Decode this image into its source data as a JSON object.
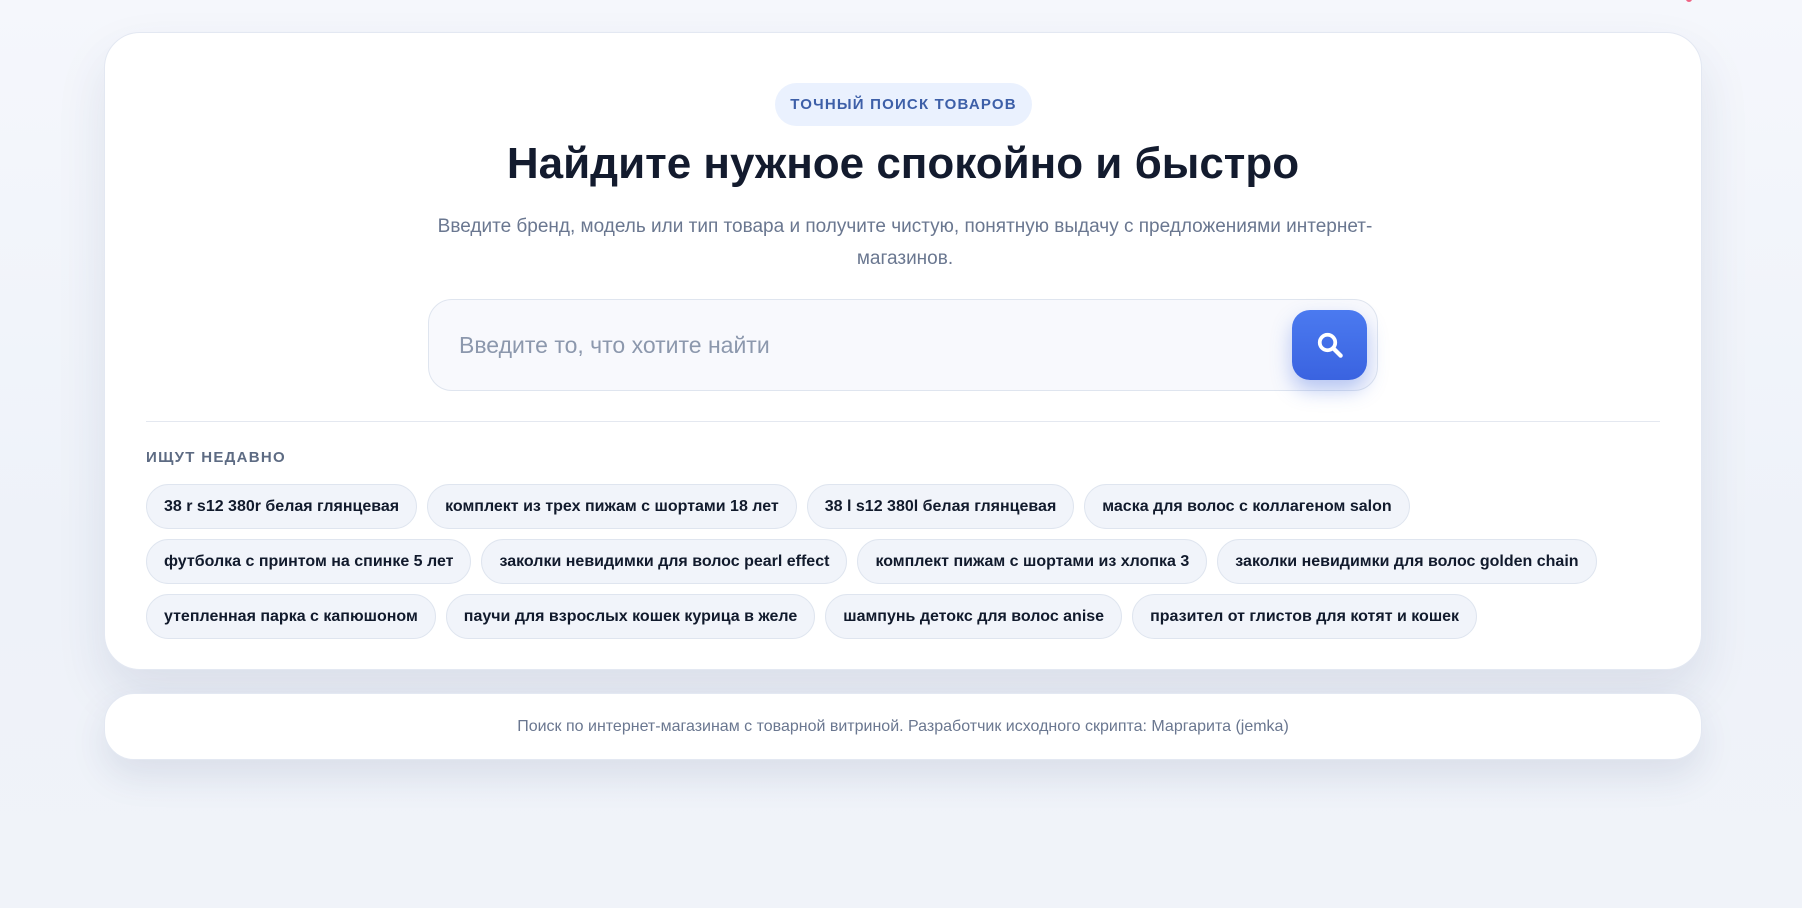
{
  "hero": {
    "badge": "ТОЧНЫЙ ПОИСК ТОВАРОВ",
    "title": "Найдите нужное спокойно и быстро",
    "subtitle": "Введите бренд, модель или тип товара и получите чистую, понятную выдачу с предложениями интернет-магазинов."
  },
  "search": {
    "placeholder": "Введите то, что хотите найти",
    "value": "",
    "button_icon": "search-icon",
    "accent_color": "#3d6ae8"
  },
  "recent": {
    "title": "ИЩУТ НЕДАВНО",
    "items": [
      "38 r s12 380r белая глянцевая",
      "комплект из трех пижам с шортами 18 лет",
      "38 l s12 380l белая глянцевая",
      "маска для волос с коллагеном salon",
      "футболка с принтом на спинке 5 лет",
      "заколки невидимки для волос pearl effect",
      "комплект пижам с шортами из хлопка 3",
      "заколки невидимки для волос golden chain",
      "утепленная парка с капюшоном",
      "паучи для взрослых кошек курица в желе",
      "шампунь детокс для волос anise",
      "празител от глистов для котят и кошек"
    ]
  },
  "footer": {
    "text": "Поиск по интернет-магазинам с товарной витриной. Разработчик исходного скрипта: Маргарита (jemka)"
  }
}
